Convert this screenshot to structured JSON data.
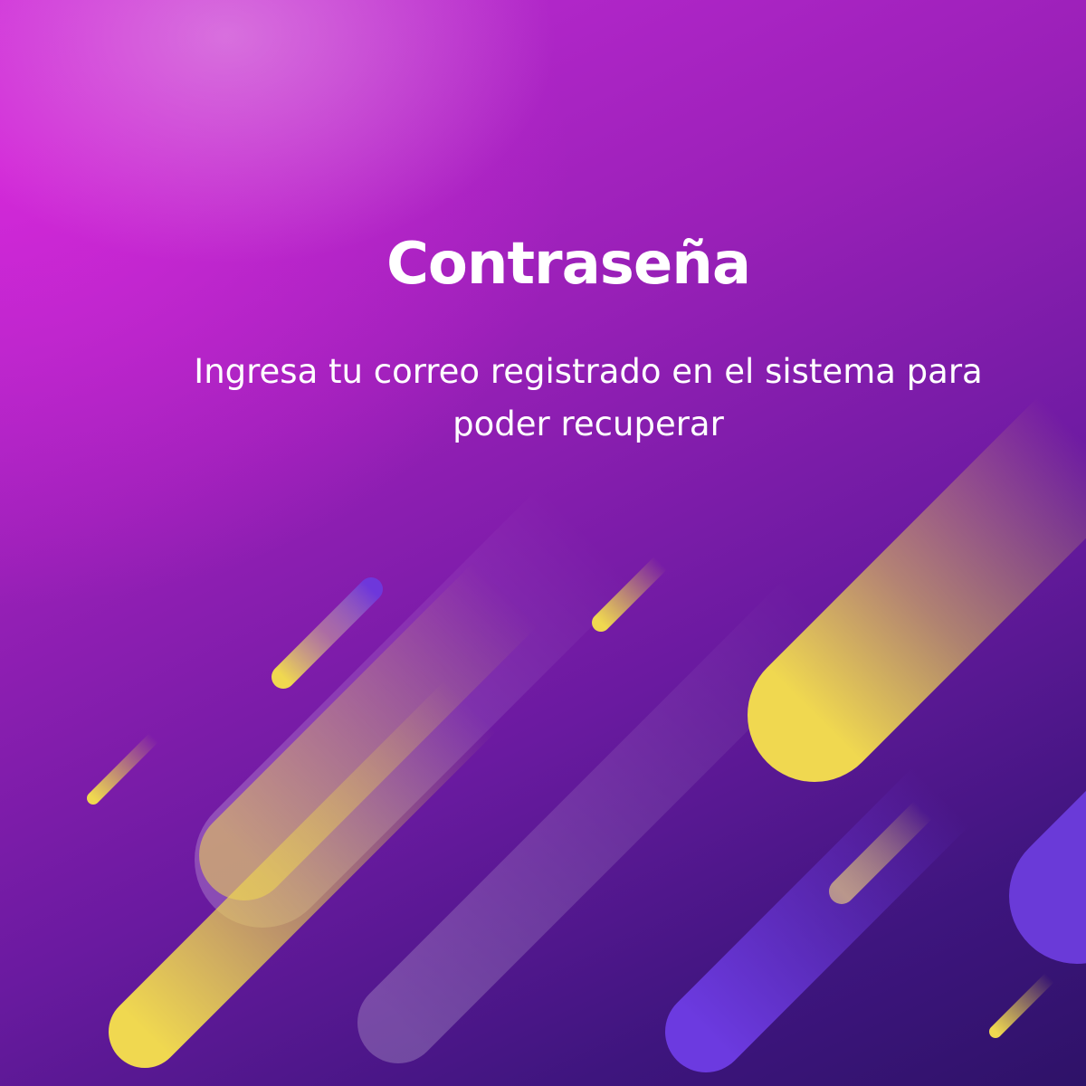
{
  "header": {
    "title": "Contraseña"
  },
  "main": {
    "description": "Ingresa tu correo registrado en el sistema para poder recuperar"
  },
  "colors": {
    "background_top": "#c42bd6",
    "background_bottom": "#2e1268",
    "accent_yellow": "#f0d850",
    "accent_violet": "#6c3ae0"
  }
}
